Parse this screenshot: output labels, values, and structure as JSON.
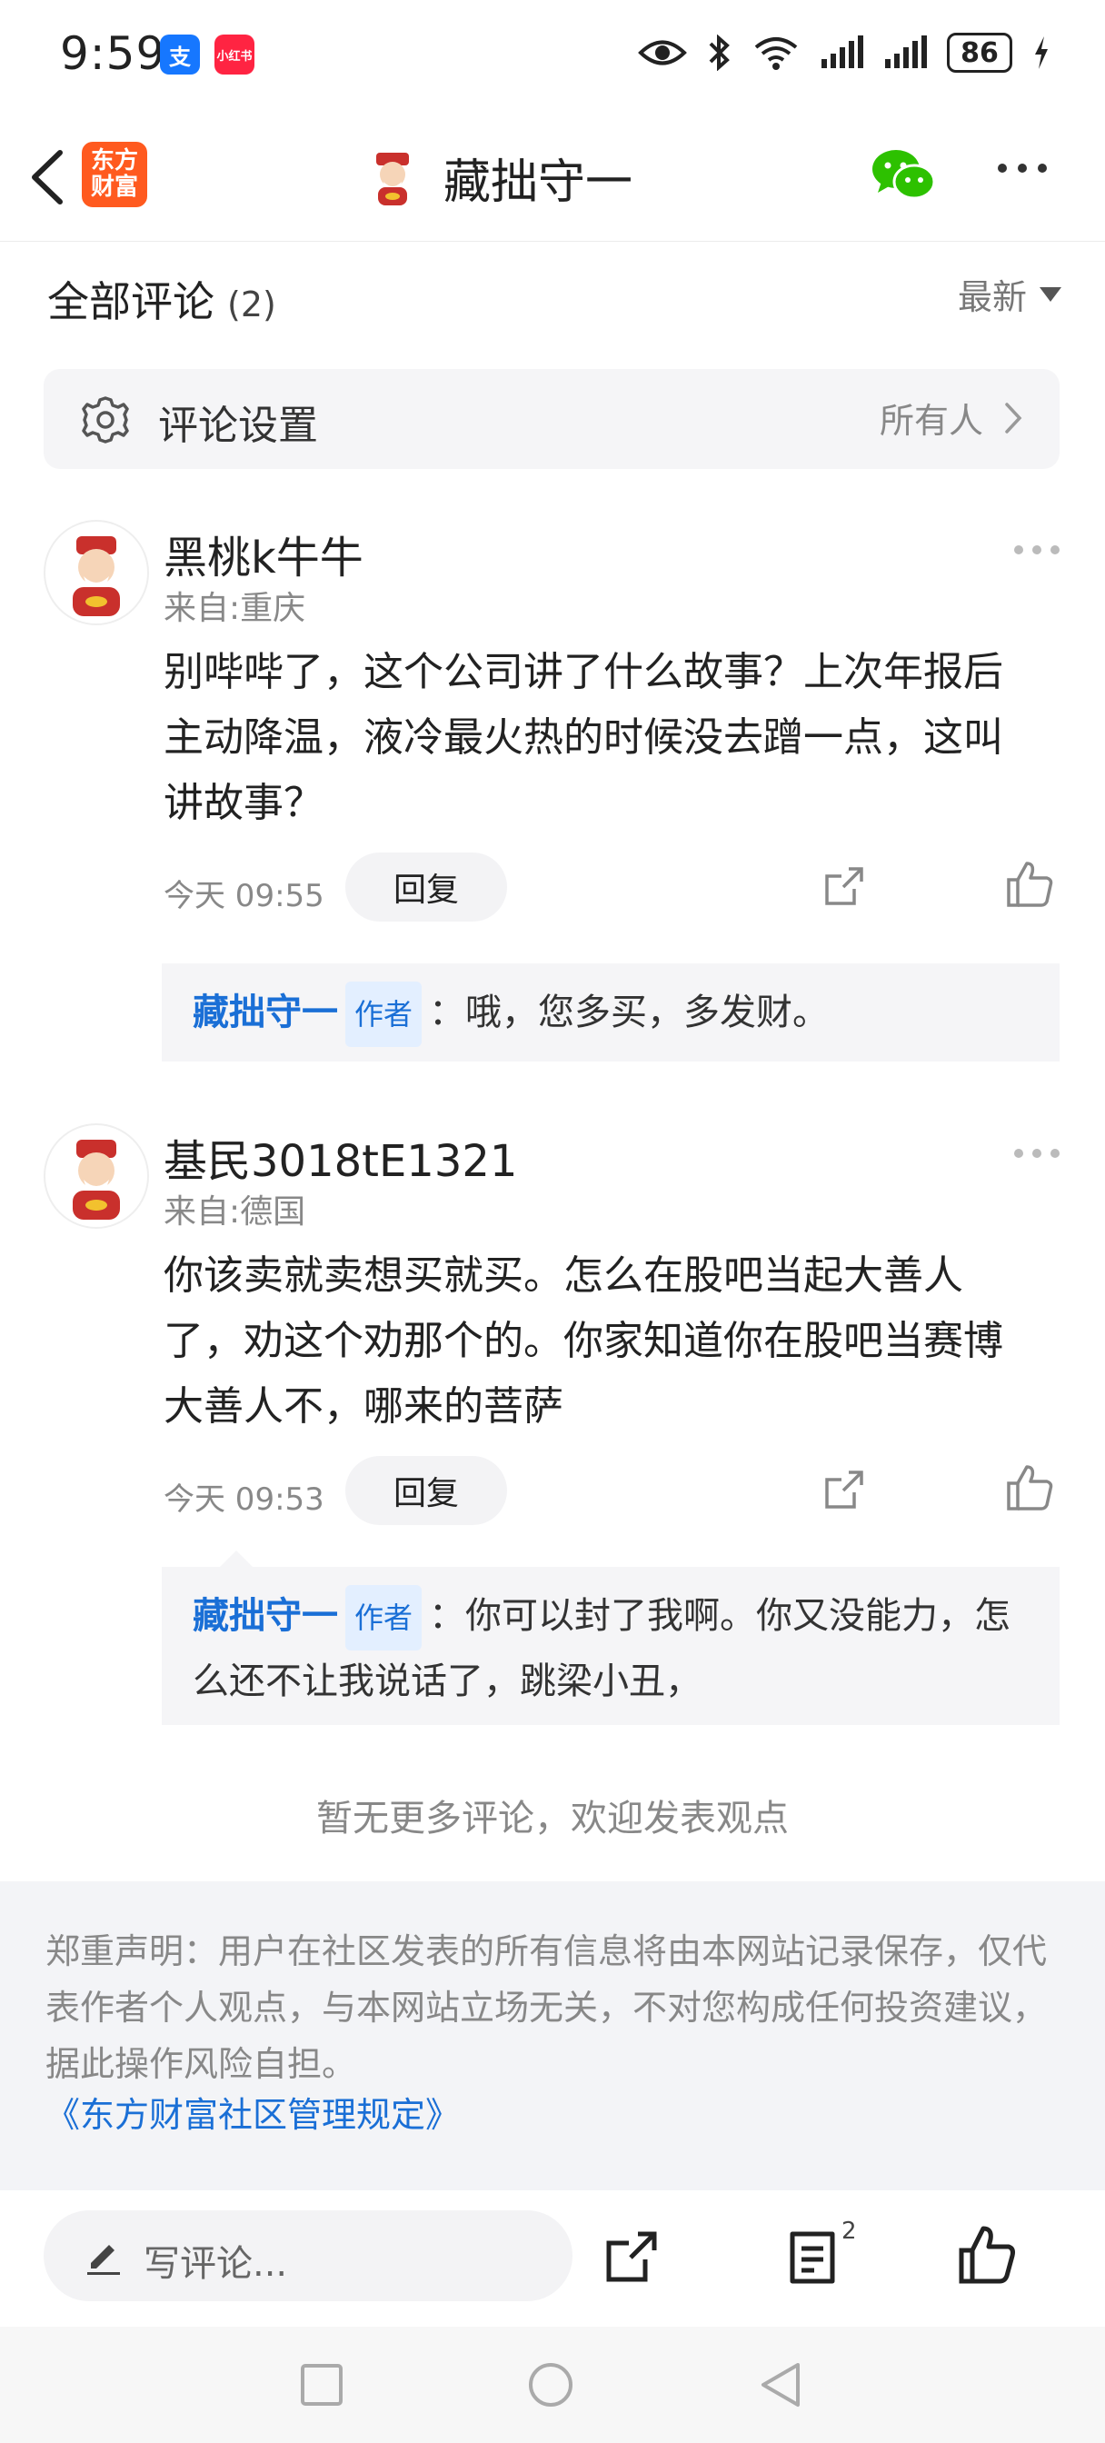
{
  "status_bar": {
    "time": "9:59",
    "app1": "支",
    "app2": "小红书",
    "battery": "86"
  },
  "nav": {
    "logo_line1": "东方",
    "logo_line2": "财富",
    "title": "藏拙守一"
  },
  "comments_header": {
    "title": "全部评论",
    "count": "(2)",
    "sort": "最新"
  },
  "settings": {
    "label": "评论设置",
    "value": "所有人"
  },
  "comments": [
    {
      "user": "黑桃k牛牛",
      "location": "来自:重庆",
      "text": "别哔哔了，这个公司讲了什么故事？上次年报后主动降温，液冷最火热的时候没去蹭一点，这叫讲故事？",
      "time": "今天 09:55",
      "reply_label": "回复",
      "reply": {
        "author": "藏拙守一",
        "tag": "作者",
        "text": "：哦，您多买，多发财。"
      }
    },
    {
      "user": "基民3018tE1321",
      "location": "来自:德国",
      "text": "你该卖就卖想买就买。怎么在股吧当起大善人了，劝这个劝那个的。你家知道你在股吧当赛博大善人不，哪来的菩萨",
      "time": "今天 09:53",
      "reply_label": "回复",
      "reply": {
        "author": "藏拙守一",
        "tag": "作者",
        "text": "：你可以封了我啊。你又没能力，怎么还不让我说话了，跳梁小丑，"
      }
    }
  ],
  "no_more": "暂无更多评论，欢迎发表观点",
  "disclaimer": {
    "text": "郑重声明：用户在社区发表的所有信息将由本网站记录保存，仅代表作者个人观点，与本网站立场无关，不对您构成任何投资建议，据此操作风险自担。",
    "link": "《东方财富社区管理规定》"
  },
  "bottom_bar": {
    "placeholder": "写评论...",
    "comment_count": "2"
  },
  "colors": {
    "accent_blue": "#1a6fd6",
    "brand_orange": "#ff5a1f",
    "wechat_green": "#2dc100"
  }
}
